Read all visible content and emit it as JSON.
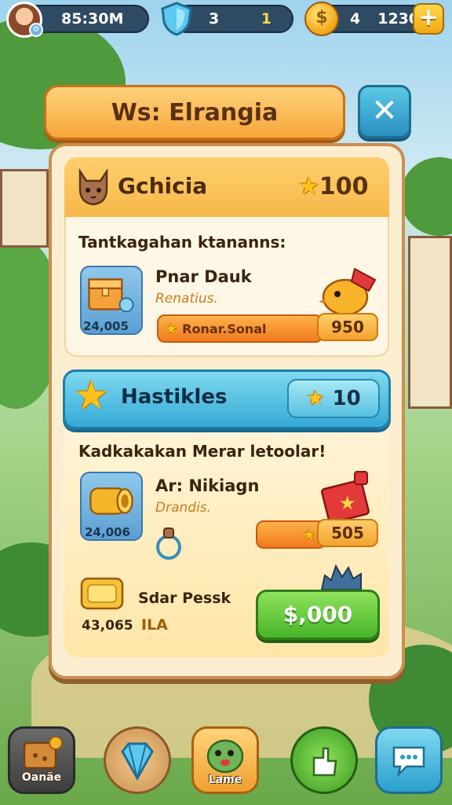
{
  "hud": {
    "currency_1": "85:30M",
    "shield_value": "3",
    "shield_level": "1",
    "coin_count": "4",
    "coin_total": "1230",
    "plus_label": "+"
  },
  "modal": {
    "title": "Ws: Elrangia",
    "close_label": "✕",
    "section1": {
      "title": "Gchicia",
      "score": "100",
      "subtitle": "Tantkagahan ktananns:",
      "item_name": "Pnar Dauk",
      "item_sub": "Renatius.",
      "card_count": "24,005",
      "bar_label": "Ronar.Sonal",
      "bar_value": "950"
    },
    "section2": {
      "title": "Hastikles",
      "pill_value": "10",
      "subtitle": "Kadkakakan Merar letoolar!",
      "item1_name": "Ar: Nikiagn",
      "item1_sub": "Drandis.",
      "item1_card_count": "24,006",
      "item1_bar_value": "505",
      "item2_name": "Sdar Pessk",
      "item2_count": "43,065",
      "item2_tag": "ILA",
      "buy_label": "$,000"
    }
  },
  "nav": {
    "btn1_label": "Oanäe",
    "btn3_label": "Lame"
  },
  "colors": {
    "banner": "#f7a63b",
    "close": "#2a8fbf",
    "modal_bg": "#fbeed0",
    "section2": "#34aad6",
    "buy": "#48b52a"
  }
}
